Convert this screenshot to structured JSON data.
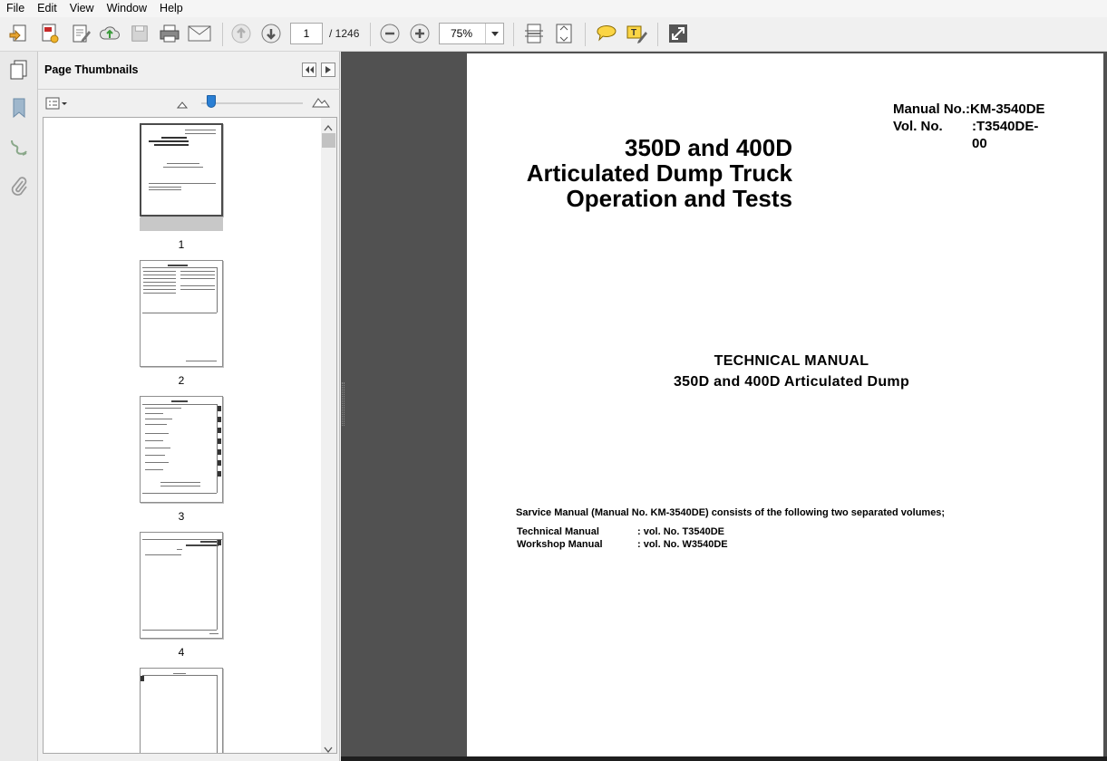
{
  "menu": [
    "File",
    "Edit",
    "View",
    "Window",
    "Help"
  ],
  "toolbar": {
    "current_page": "1",
    "page_total": "/ 1246",
    "zoom": "75%"
  },
  "panel": {
    "title": "Page Thumbnails"
  },
  "thumbnails": [
    "1",
    "2",
    "3",
    "4"
  ],
  "document": {
    "manual_no_line": "Manual No.:KM-3540DE",
    "vol_no_label": "Vol. No.",
    "vol_no_value": ":T3540DE-00",
    "title_line1": "350D and 400D",
    "title_line2": "Articulated Dump Truck",
    "title_line3": "Operation and Tests",
    "tech_heading": "TECHNICAL MANUAL",
    "tech_sub": "350D and 400D Articulated Dump",
    "service_note": "Sarvice Manual (Manual No. KM-3540DE) consists of the following two separated volumes;",
    "volumes": [
      {
        "name": "Technical Manual",
        "value": ": vol. No. T3540DE"
      },
      {
        "name": "Workshop Manual",
        "value": ": vol. No. W3540DE"
      }
    ]
  }
}
